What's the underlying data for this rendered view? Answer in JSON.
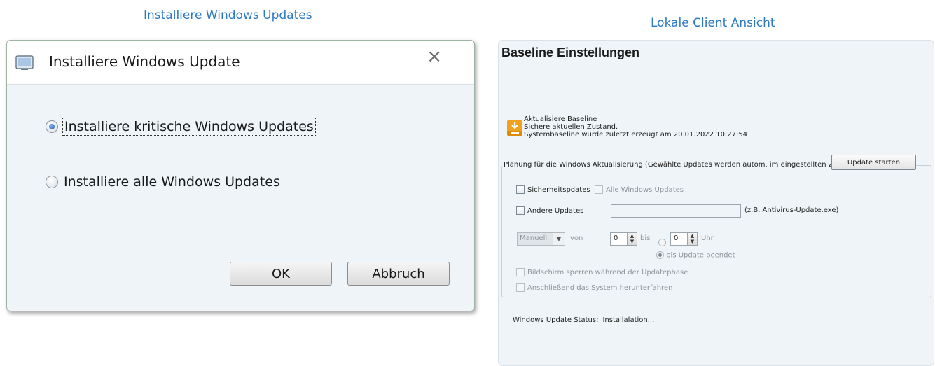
{
  "captions": {
    "left": "Installiere Windows Updates",
    "right": "Lokale Client Ansicht"
  },
  "dialog": {
    "title": "Installiere Windows Update",
    "close_glyph": "×",
    "icon": "window-icon",
    "options": [
      {
        "label": "Installiere kritische Windows Updates",
        "checked": true
      },
      {
        "label": "Installiere alle Windows Updates",
        "checked": false
      }
    ],
    "ok_label": "OK",
    "cancel_label": "Abbruch"
  },
  "panel": {
    "heading": "Baseline Einstellungen",
    "baseline": {
      "icon": "download-drive-icon",
      "line1": "Aktualisiere Baseline",
      "line2": "Sichere aktuellen Zustand.",
      "line3": "Systembaseline wurde zuletzt erzeugt am 20.01.2022 10:27:54"
    },
    "group": {
      "legend": "Planung für die Windows Aktualisierung (Gewählte Updates werden autom. im eingestellten Zeitfenster ausgeführt)",
      "security_label": "Sicherheitspdates",
      "all_updates_label": "Alle Windows Updates",
      "other_updates_label": "Andere Updates",
      "other_updates_value": "",
      "other_updates_hint": "(z.B. Antivirus-Update.exe)",
      "mode_value": "Manuell",
      "from_label": "von",
      "from_value": "0",
      "to_label": "bis",
      "to_value": "0",
      "hour_label": "Uhr",
      "until_done_label": "bis Update beendet",
      "lock_screen_label": "Bildschirm sperren während der Updatephase",
      "shutdown_label": "Anschließend das System herunterfahren",
      "start_button": "Update starten"
    },
    "status_label": "Windows Update Status:",
    "status_value": "Installalation..."
  },
  "colors": {
    "caption": "#2b79c2",
    "panel_bg": "#eef4f7",
    "dialog_bg": "#eef4f7",
    "baseline_icon": "#f0a21c"
  }
}
